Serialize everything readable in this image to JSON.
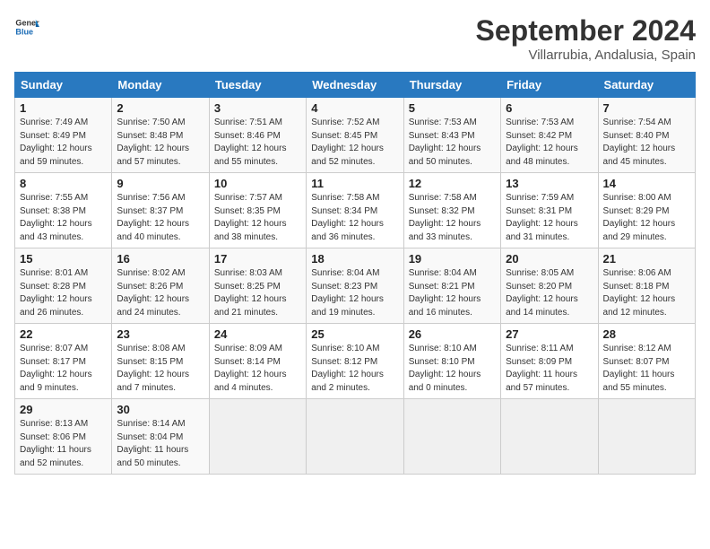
{
  "header": {
    "logo_line1": "General",
    "logo_line2": "Blue",
    "month": "September 2024",
    "location": "Villarrubia, Andalusia, Spain"
  },
  "weekdays": [
    "Sunday",
    "Monday",
    "Tuesday",
    "Wednesday",
    "Thursday",
    "Friday",
    "Saturday"
  ],
  "weeks": [
    [
      {
        "day": "1",
        "sunrise": "7:49 AM",
        "sunset": "8:49 PM",
        "daylight": "12 hours and 59 minutes."
      },
      {
        "day": "2",
        "sunrise": "7:50 AM",
        "sunset": "8:48 PM",
        "daylight": "12 hours and 57 minutes."
      },
      {
        "day": "3",
        "sunrise": "7:51 AM",
        "sunset": "8:46 PM",
        "daylight": "12 hours and 55 minutes."
      },
      {
        "day": "4",
        "sunrise": "7:52 AM",
        "sunset": "8:45 PM",
        "daylight": "12 hours and 52 minutes."
      },
      {
        "day": "5",
        "sunrise": "7:53 AM",
        "sunset": "8:43 PM",
        "daylight": "12 hours and 50 minutes."
      },
      {
        "day": "6",
        "sunrise": "7:53 AM",
        "sunset": "8:42 PM",
        "daylight": "12 hours and 48 minutes."
      },
      {
        "day": "7",
        "sunrise": "7:54 AM",
        "sunset": "8:40 PM",
        "daylight": "12 hours and 45 minutes."
      }
    ],
    [
      {
        "day": "8",
        "sunrise": "7:55 AM",
        "sunset": "8:38 PM",
        "daylight": "12 hours and 43 minutes."
      },
      {
        "day": "9",
        "sunrise": "7:56 AM",
        "sunset": "8:37 PM",
        "daylight": "12 hours and 40 minutes."
      },
      {
        "day": "10",
        "sunrise": "7:57 AM",
        "sunset": "8:35 PM",
        "daylight": "12 hours and 38 minutes."
      },
      {
        "day": "11",
        "sunrise": "7:58 AM",
        "sunset": "8:34 PM",
        "daylight": "12 hours and 36 minutes."
      },
      {
        "day": "12",
        "sunrise": "7:58 AM",
        "sunset": "8:32 PM",
        "daylight": "12 hours and 33 minutes."
      },
      {
        "day": "13",
        "sunrise": "7:59 AM",
        "sunset": "8:31 PM",
        "daylight": "12 hours and 31 minutes."
      },
      {
        "day": "14",
        "sunrise": "8:00 AM",
        "sunset": "8:29 PM",
        "daylight": "12 hours and 29 minutes."
      }
    ],
    [
      {
        "day": "15",
        "sunrise": "8:01 AM",
        "sunset": "8:28 PM",
        "daylight": "12 hours and 26 minutes."
      },
      {
        "day": "16",
        "sunrise": "8:02 AM",
        "sunset": "8:26 PM",
        "daylight": "12 hours and 24 minutes."
      },
      {
        "day": "17",
        "sunrise": "8:03 AM",
        "sunset": "8:25 PM",
        "daylight": "12 hours and 21 minutes."
      },
      {
        "day": "18",
        "sunrise": "8:04 AM",
        "sunset": "8:23 PM",
        "daylight": "12 hours and 19 minutes."
      },
      {
        "day": "19",
        "sunrise": "8:04 AM",
        "sunset": "8:21 PM",
        "daylight": "12 hours and 16 minutes."
      },
      {
        "day": "20",
        "sunrise": "8:05 AM",
        "sunset": "8:20 PM",
        "daylight": "12 hours and 14 minutes."
      },
      {
        "day": "21",
        "sunrise": "8:06 AM",
        "sunset": "8:18 PM",
        "daylight": "12 hours and 12 minutes."
      }
    ],
    [
      {
        "day": "22",
        "sunrise": "8:07 AM",
        "sunset": "8:17 PM",
        "daylight": "12 hours and 9 minutes."
      },
      {
        "day": "23",
        "sunrise": "8:08 AM",
        "sunset": "8:15 PM",
        "daylight": "12 hours and 7 minutes."
      },
      {
        "day": "24",
        "sunrise": "8:09 AM",
        "sunset": "8:14 PM",
        "daylight": "12 hours and 4 minutes."
      },
      {
        "day": "25",
        "sunrise": "8:10 AM",
        "sunset": "8:12 PM",
        "daylight": "12 hours and 2 minutes."
      },
      {
        "day": "26",
        "sunrise": "8:10 AM",
        "sunset": "8:10 PM",
        "daylight": "12 hours and 0 minutes."
      },
      {
        "day": "27",
        "sunrise": "8:11 AM",
        "sunset": "8:09 PM",
        "daylight": "11 hours and 57 minutes."
      },
      {
        "day": "28",
        "sunrise": "8:12 AM",
        "sunset": "8:07 PM",
        "daylight": "11 hours and 55 minutes."
      }
    ],
    [
      {
        "day": "29",
        "sunrise": "8:13 AM",
        "sunset": "8:06 PM",
        "daylight": "11 hours and 52 minutes."
      },
      {
        "day": "30",
        "sunrise": "8:14 AM",
        "sunset": "8:04 PM",
        "daylight": "11 hours and 50 minutes."
      },
      null,
      null,
      null,
      null,
      null
    ]
  ]
}
